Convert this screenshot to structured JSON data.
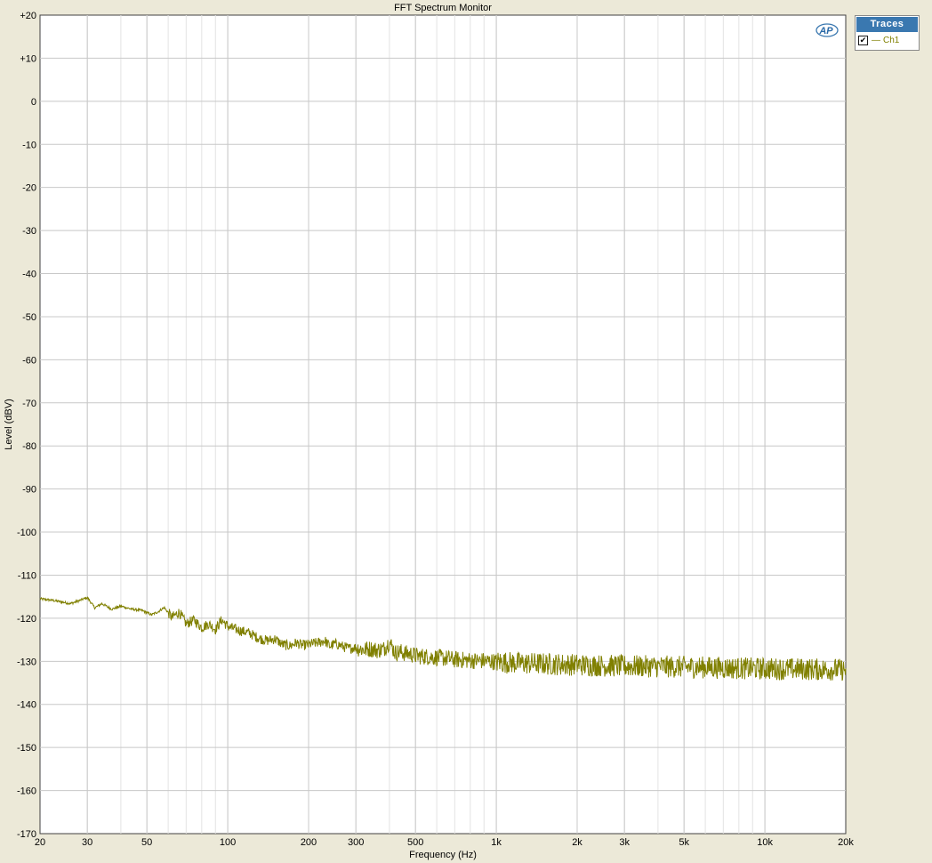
{
  "chart_data": {
    "type": "line",
    "title": "FFT Spectrum Monitor",
    "xlabel": "Frequency (Hz)",
    "ylabel": "Level (dBV)",
    "x_scale": "log",
    "xlim": [
      20,
      20000
    ],
    "ylim": [
      -170,
      20
    ],
    "x_ticks": [
      {
        "value": 20,
        "label": "20"
      },
      {
        "value": 30,
        "label": "30"
      },
      {
        "value": 50,
        "label": "50"
      },
      {
        "value": 100,
        "label": "100"
      },
      {
        "value": 200,
        "label": "200"
      },
      {
        "value": 300,
        "label": "300"
      },
      {
        "value": 500,
        "label": "500"
      },
      {
        "value": 1000,
        "label": "1k"
      },
      {
        "value": 2000,
        "label": "2k"
      },
      {
        "value": 3000,
        "label": "3k"
      },
      {
        "value": 5000,
        "label": "5k"
      },
      {
        "value": 10000,
        "label": "10k"
      },
      {
        "value": 20000,
        "label": "20k"
      }
    ],
    "y_ticks": [
      {
        "value": 20,
        "label": "+20"
      },
      {
        "value": 10,
        "label": "+10"
      },
      {
        "value": 0,
        "label": "0"
      },
      {
        "value": -10,
        "label": "-10"
      },
      {
        "value": -20,
        "label": "-20"
      },
      {
        "value": -30,
        "label": "-30"
      },
      {
        "value": -40,
        "label": "-40"
      },
      {
        "value": -50,
        "label": "-50"
      },
      {
        "value": -60,
        "label": "-60"
      },
      {
        "value": -70,
        "label": "-70"
      },
      {
        "value": -80,
        "label": "-80"
      },
      {
        "value": -90,
        "label": "-90"
      },
      {
        "value": -100,
        "label": "-100"
      },
      {
        "value": -110,
        "label": "-110"
      },
      {
        "value": -120,
        "label": "-120"
      },
      {
        "value": -130,
        "label": "-130"
      },
      {
        "value": -140,
        "label": "-140"
      },
      {
        "value": -150,
        "label": "-150"
      },
      {
        "value": -160,
        "label": "-160"
      },
      {
        "value": -170,
        "label": "-170"
      }
    ],
    "grid": true,
    "series": [
      {
        "name": "Ch1",
        "color": "#808000",
        "x": [
          20,
          22,
          24,
          26,
          28,
          30,
          32,
          34,
          37,
          40,
          44,
          48,
          52,
          55,
          58,
          62,
          66,
          70,
          75,
          80,
          85,
          90,
          95,
          100,
          110,
          120,
          130,
          140,
          150,
          160,
          170,
          180,
          190,
          200,
          210,
          220,
          230,
          240,
          250,
          260,
          280,
          300,
          320,
          340,
          360,
          380,
          400,
          420,
          440,
          460,
          480,
          500,
          550,
          600,
          650,
          700,
          800,
          900,
          1000,
          1200,
          1500,
          2000,
          2500,
          3000,
          4000,
          5000,
          6000,
          7000,
          8000,
          9000,
          10000,
          12000,
          14000,
          16000,
          18000,
          20000
        ],
        "y": [
          -115.5,
          -115.8,
          -116.2,
          -116.6,
          -115.9,
          -115.2,
          -117.6,
          -116.6,
          -117.9,
          -117.2,
          -117.9,
          -118.2,
          -119.2,
          -118.5,
          -117.5,
          -119.8,
          -118.6,
          -121.3,
          -120.4,
          -122.2,
          -121.3,
          -122.6,
          -120.4,
          -121.9,
          -122.8,
          -123.4,
          -124.6,
          -125.2,
          -124.8,
          -126.1,
          -126.4,
          -125.7,
          -126.3,
          -126.1,
          -125.8,
          -125.6,
          -125.2,
          -126.5,
          -125.9,
          -126.2,
          -127.0,
          -126.8,
          -127.3,
          -127.1,
          -127.4,
          -127.2,
          -125.5,
          -128.0,
          -127.8,
          -128.2,
          -128.3,
          -128.7,
          -128.9,
          -129.1,
          -129.3,
          -129.6,
          -129.8,
          -129.9,
          -130.1,
          -130.4,
          -130.6,
          -130.8,
          -131.0,
          -131.1,
          -131.2,
          -131.3,
          -131.4,
          -131.5,
          -131.6,
          -131.7,
          -131.7,
          -131.8,
          -131.8,
          -131.9,
          -131.9,
          -132.0
        ]
      }
    ],
    "legend": {
      "title": "Traces",
      "placement": "outside-right-top"
    }
  },
  "traces": {
    "title": "Traces",
    "items": [
      {
        "label": "Ch1",
        "checked": true
      }
    ]
  },
  "logo": {
    "text": "AP"
  }
}
